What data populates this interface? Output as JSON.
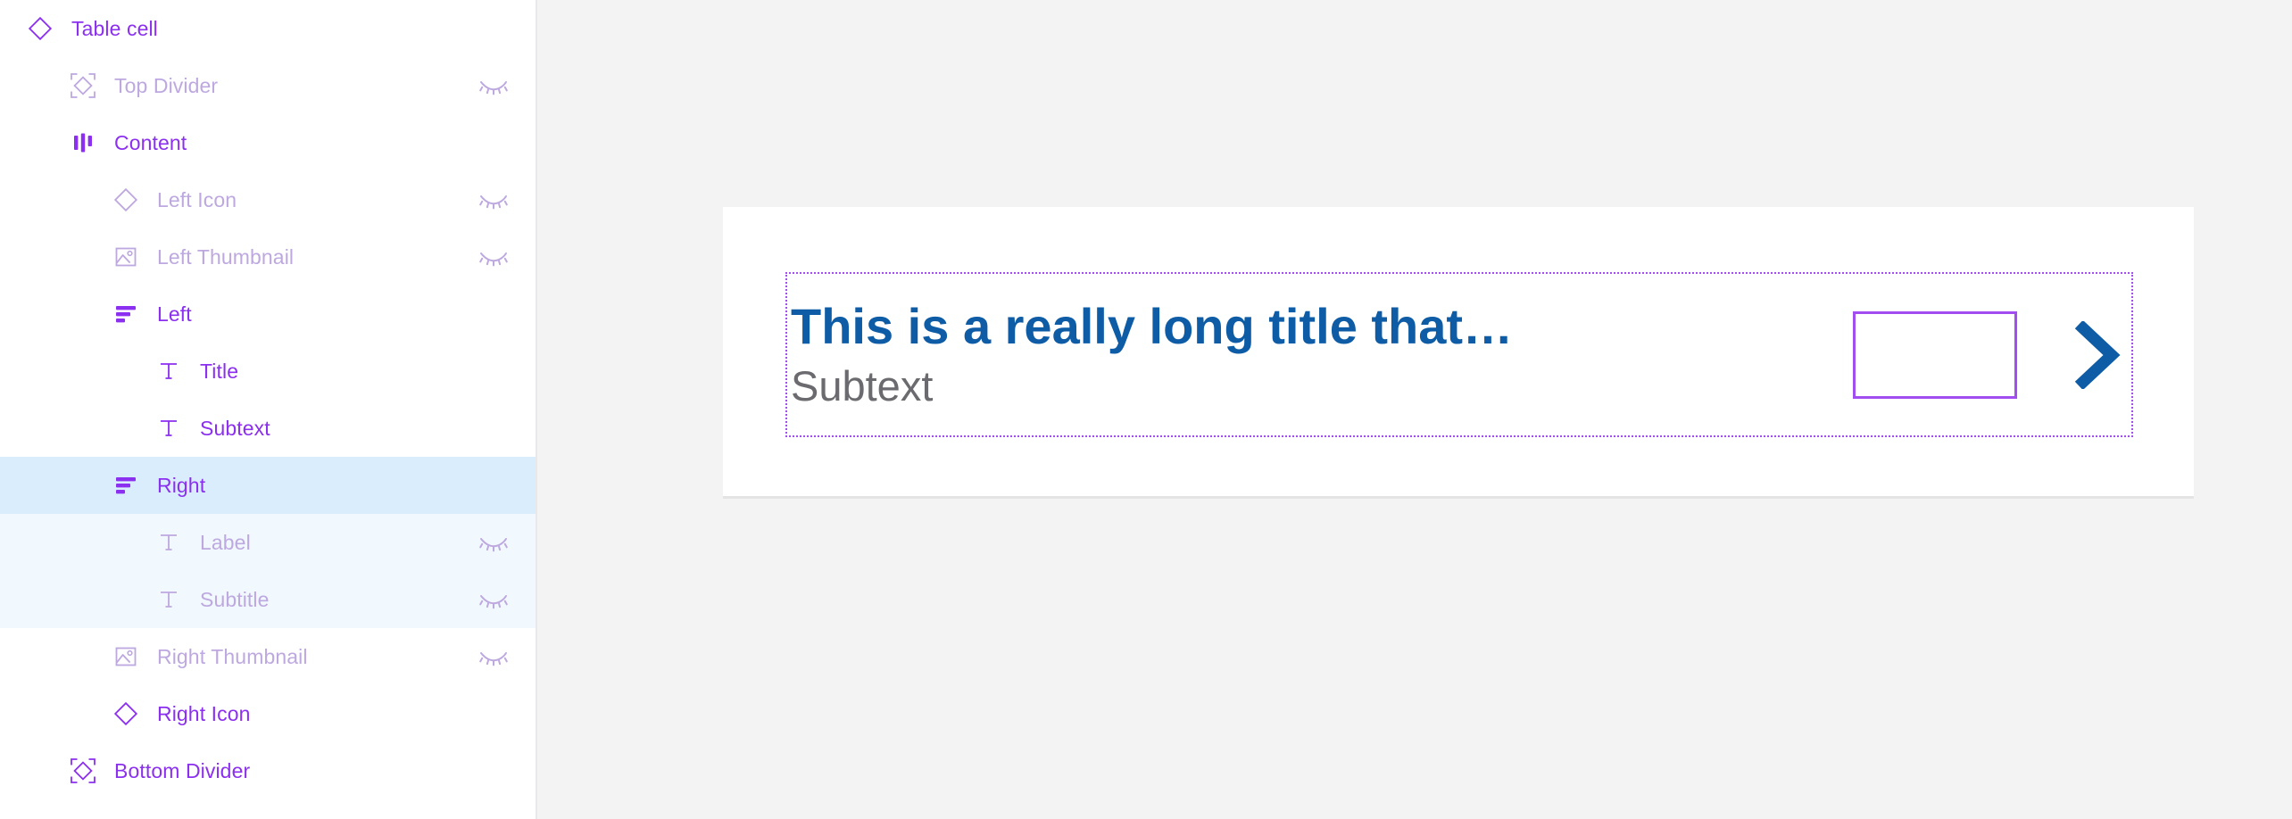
{
  "layers_panel": {
    "rows": [
      {
        "label": "Table cell",
        "icon": "component-diamond-icon",
        "indent": 0,
        "tone": "strong",
        "hidden_icon": false,
        "state": "none"
      },
      {
        "label": "Top Divider",
        "icon": "instance-diamond-icon",
        "indent": 1,
        "tone": "muted",
        "hidden_icon": true,
        "state": "none"
      },
      {
        "label": "Content",
        "icon": "autolayout-horizontal-icon",
        "indent": 1,
        "tone": "strong",
        "hidden_icon": false,
        "state": "none"
      },
      {
        "label": "Left Icon",
        "icon": "component-diamond-icon",
        "indent": 2,
        "tone": "muted",
        "hidden_icon": true,
        "state": "none"
      },
      {
        "label": "Left Thumbnail",
        "icon": "image-icon",
        "indent": 2,
        "tone": "muted",
        "hidden_icon": true,
        "state": "none"
      },
      {
        "label": "Left",
        "icon": "autolayout-vertical-icon",
        "indent": 2,
        "tone": "strong",
        "hidden_icon": false,
        "state": "none"
      },
      {
        "label": "Title",
        "icon": "text-icon",
        "indent": 3,
        "tone": "strong",
        "hidden_icon": false,
        "state": "none"
      },
      {
        "label": "Subtext",
        "icon": "text-icon",
        "indent": 3,
        "tone": "strong",
        "hidden_icon": false,
        "state": "none"
      },
      {
        "label": "Right",
        "icon": "autolayout-vertical-icon",
        "indent": 2,
        "tone": "strong",
        "hidden_icon": false,
        "state": "selected"
      },
      {
        "label": "Label",
        "icon": "text-icon",
        "indent": 3,
        "tone": "muted",
        "hidden_icon": true,
        "state": "child-of-selected"
      },
      {
        "label": "Subtitle",
        "icon": "text-icon",
        "indent": 3,
        "tone": "muted",
        "hidden_icon": true,
        "state": "child-of-selected"
      },
      {
        "label": "Right Thumbnail",
        "icon": "image-icon",
        "indent": 2,
        "tone": "muted",
        "hidden_icon": true,
        "state": "none"
      },
      {
        "label": "Right Icon",
        "icon": "component-diamond-icon",
        "indent": 2,
        "tone": "strong",
        "hidden_icon": false,
        "state": "none"
      },
      {
        "label": "Bottom Divider",
        "icon": "instance-diamond-icon",
        "indent": 1,
        "tone": "strong",
        "hidden_icon": false,
        "state": "none"
      }
    ]
  },
  "canvas": {
    "table_cell": {
      "title": "This is a really long title that…",
      "subtext": "Subtext",
      "right_label": "",
      "right_subtitle": "",
      "right_icon": "chevron-right-icon"
    }
  },
  "colors": {
    "layer_strong": "#8B2FF0",
    "layer_muted": "#BDA8E0",
    "selection_row": "#DAEDFC",
    "selection_row_child": "#F1F8FE",
    "selection_outline": "#A24DF0",
    "title_blue": "#0E5CA6",
    "subtext_gray": "#6B6B6F",
    "canvas_bg": "#F3F3F4",
    "card_bg": "#FFFFFF"
  }
}
